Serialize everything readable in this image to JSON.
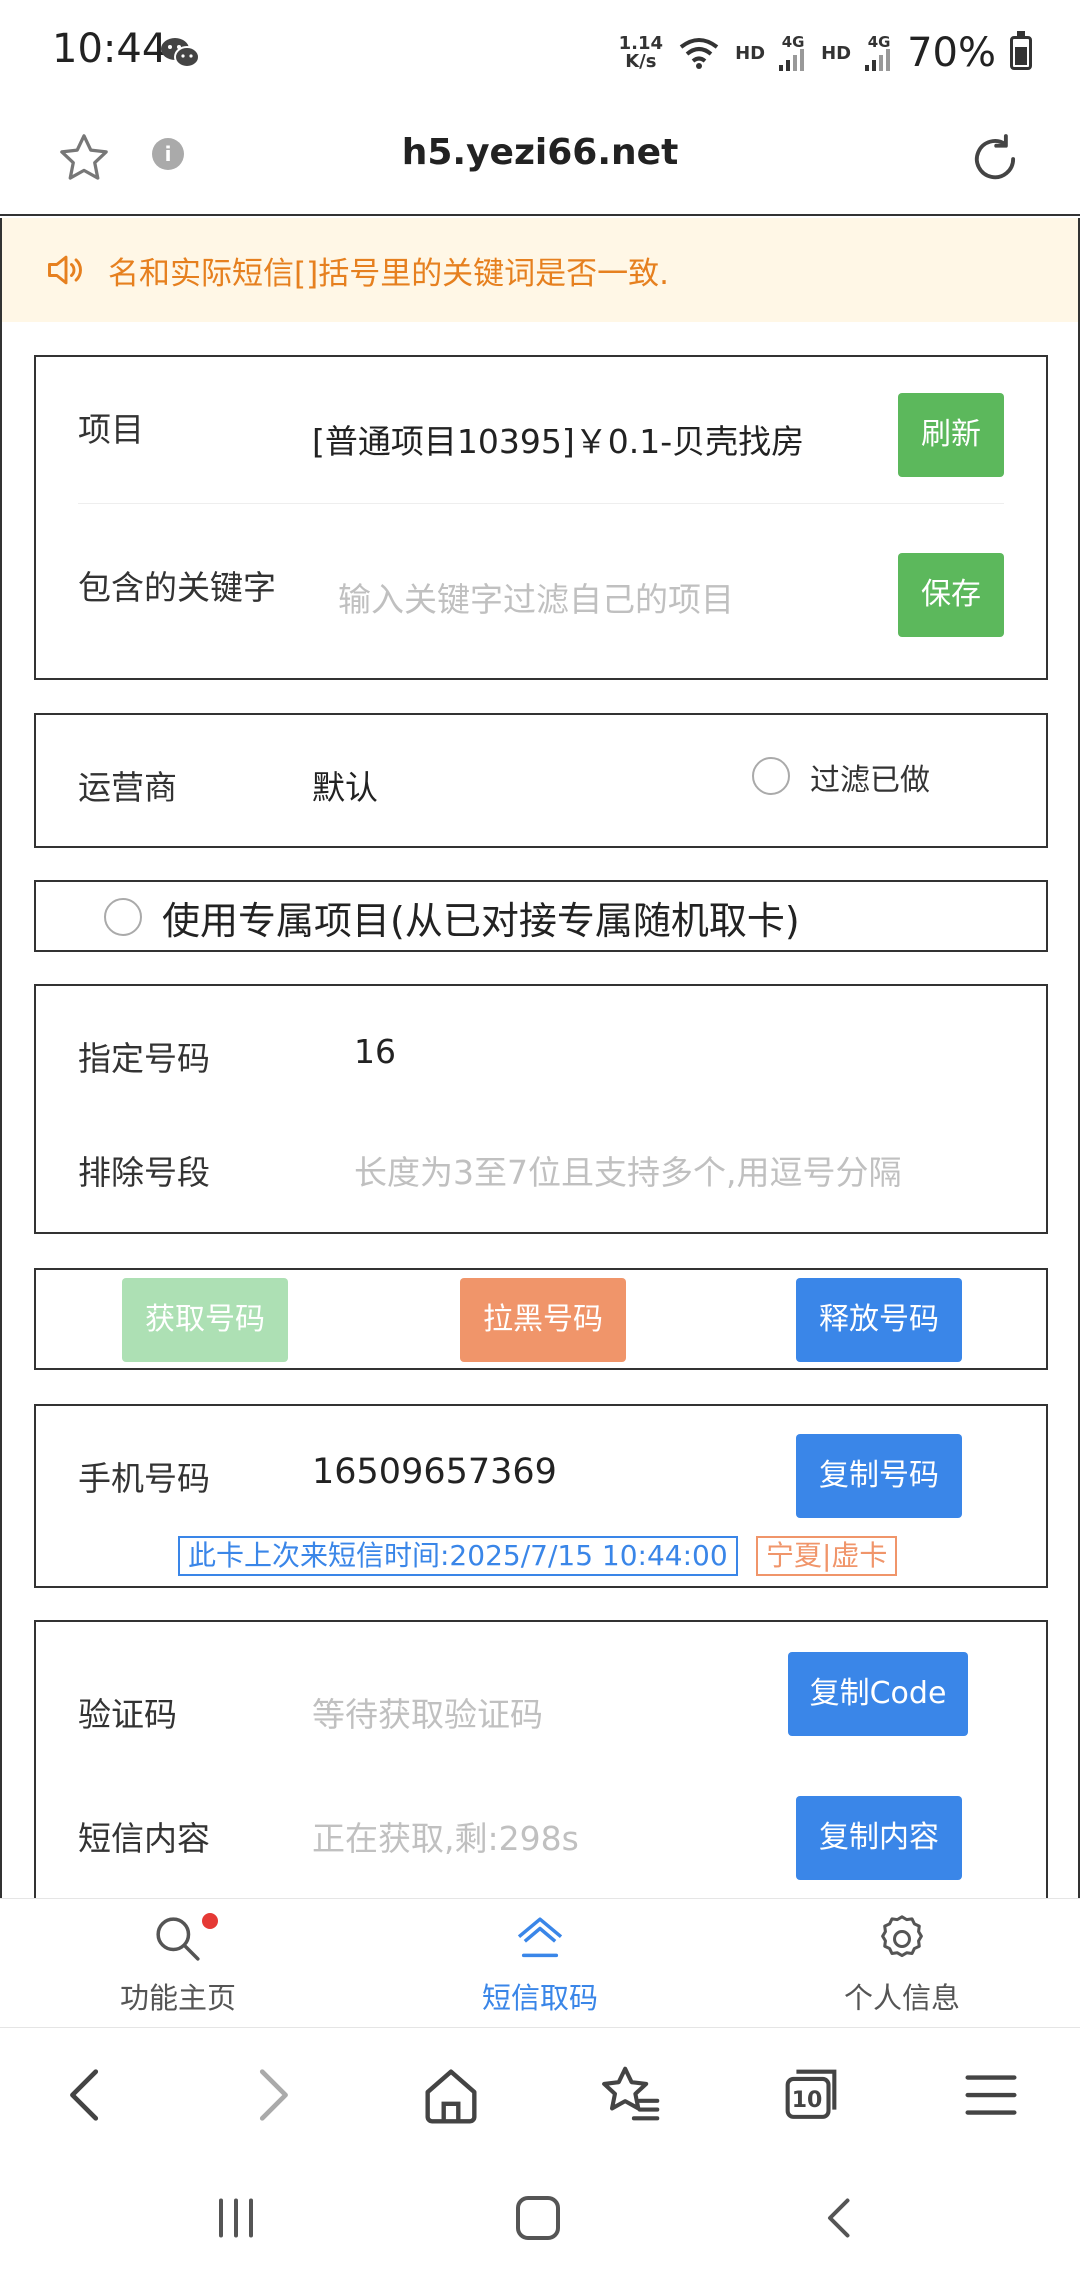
{
  "status_bar": {
    "time": "10:44",
    "speed_top": "1.14",
    "speed_bottom": "K/s",
    "hd1": "HD",
    "net1": "4G",
    "hd2": "HD",
    "net2": "4G",
    "battery": "70%"
  },
  "address_bar": {
    "url": "h5.yezi66.net"
  },
  "notice": {
    "text": "名和实际短信[]括号里的关键词是否一致."
  },
  "project_box": {
    "project_label": "项目",
    "project_value": "[普通项目10395]￥0.1-贝壳找房",
    "refresh_button": "刷新",
    "keyword_label": "包含的关键字",
    "keyword_placeholder": "输入关键字过滤自己的项目",
    "save_button": "保存"
  },
  "operator_box": {
    "operator_label": "运营商",
    "operator_value": "默认",
    "filter_done_label": "过滤已做"
  },
  "exclusive_box": {
    "label": "使用专属项目(从已对接专属随机取卡)"
  },
  "number_box": {
    "specified_label": "指定号码",
    "specified_value": "16",
    "exclude_label": "排除号段",
    "exclude_placeholder": "长度为3至7位且支持多个,用逗号分隔"
  },
  "actions": {
    "get_number": "获取号码",
    "blacklist_number": "拉黑号码",
    "release_number": "释放号码"
  },
  "phone_box": {
    "phone_label": "手机号码",
    "phone_value": "16509657369",
    "copy_number_button": "复制号码",
    "last_sms_tag": "此卡上次来短信时间:2025/7/15 10:44:00",
    "region_tag": "宁夏|虚卡"
  },
  "code_box": {
    "code_label": "验证码",
    "code_placeholder": "等待获取验证码",
    "copy_code_button": "复制Code",
    "sms_label": "短信内容",
    "sms_status": "正在获取,剩:298s",
    "copy_content_button": "复制内容"
  },
  "tabbar": {
    "tabs": [
      {
        "label": "功能主页",
        "icon": "search-icon"
      },
      {
        "label": "短信取码",
        "icon": "home-icon"
      },
      {
        "label": "个人信息",
        "icon": "gear-icon"
      }
    ],
    "active_index": 1,
    "accent": "#3a86e8"
  },
  "browser_toolbar": {
    "tabs_count": "10"
  },
  "colors": {
    "green": "#5cb85c",
    "blue": "#3a86e8",
    "orange": "#f0956a",
    "notice_text": "#e6801f",
    "notice_bg": "#fff7e6"
  }
}
